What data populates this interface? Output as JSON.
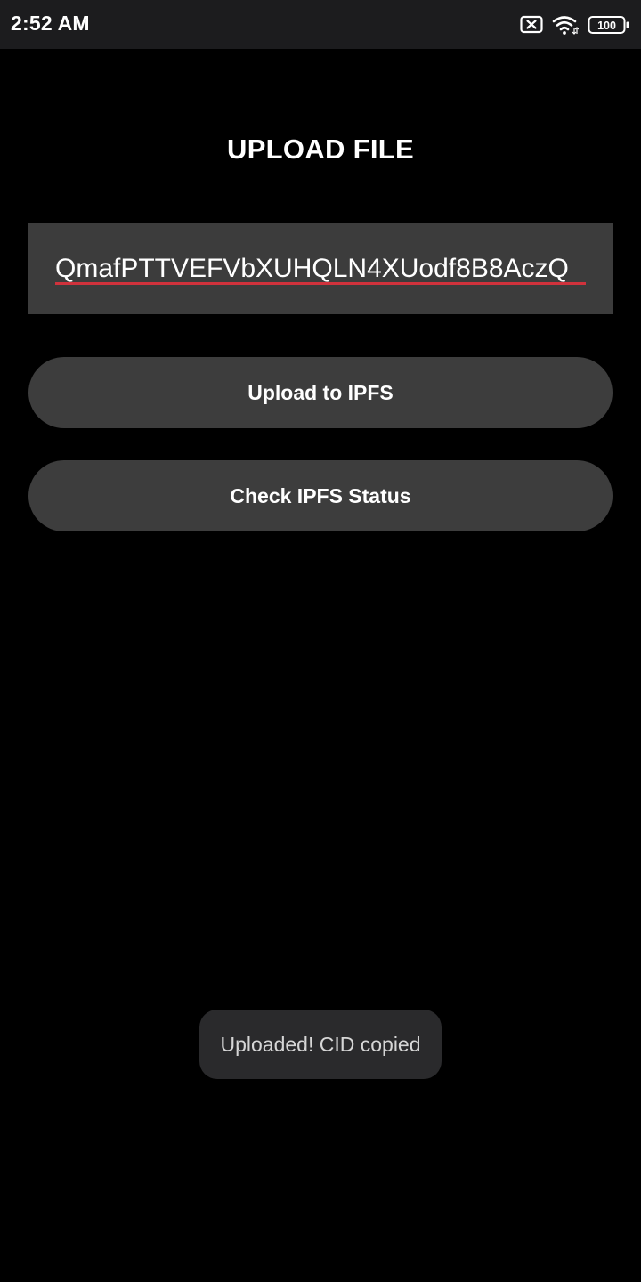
{
  "status_bar": {
    "time": "2:52 AM",
    "battery_level": "100",
    "icons": [
      "sim-off-icon",
      "wifi-icon",
      "battery-icon"
    ]
  },
  "main": {
    "title": "UPLOAD FILE",
    "cid_field": {
      "value": "QmafPTTVEFVbXUHQLN4XUodf8B8AczQ"
    },
    "buttons": {
      "upload_label": "Upload to IPFS",
      "status_label": "Check IPFS Status"
    }
  },
  "toast": {
    "message": "Uploaded! CID copied"
  },
  "colors": {
    "background": "#000000",
    "status_bar": "#1c1c1e",
    "field_background": "#3c3c3c",
    "button_background": "#3d3d3d",
    "spellcheck_underline": "#d0323c",
    "toast_background": "#2a2a2c"
  }
}
